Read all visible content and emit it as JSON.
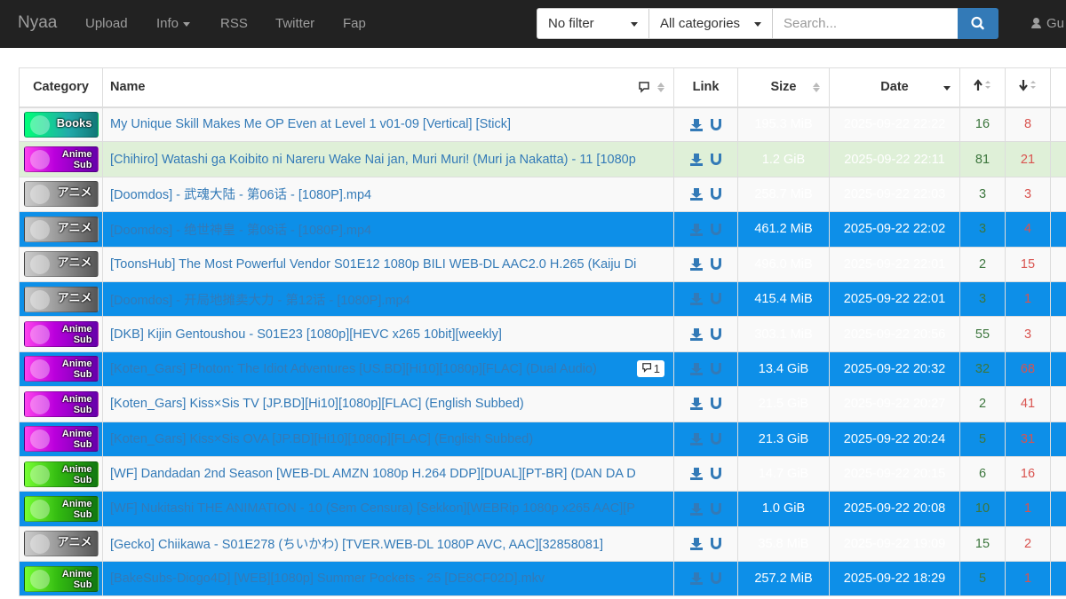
{
  "nav": {
    "brand": "Nyaa",
    "items": [
      "Upload",
      "Info",
      "RSS",
      "Twitter",
      "Fap"
    ],
    "filter": "No filter",
    "category": "All categories",
    "search_placeholder": "Search...",
    "user": "Gu"
  },
  "headers": {
    "category": "Category",
    "name": "Name",
    "link": "Link",
    "size": "Size",
    "date": "Date"
  },
  "rows": [
    {
      "cat": "books",
      "cat_label": "Books",
      "name": "My Unique Skill Makes Me OP Even at Level 1 v01-09 [Vertical] [Stick]",
      "size": "195.3 MiB",
      "date": "2025-09-22 22:22",
      "seeders": "16",
      "leechers": "8",
      "style": "default",
      "comments": ""
    },
    {
      "cat": "sub",
      "cat_label": "Anime Sub",
      "name": "[Chihiro] Watashi ga Koibito ni Nareru Wake Nai jan, Muri Muri! (Muri ja Nakatta) - 11 [1080p",
      "size": "1.2 GiB",
      "date": "2025-09-22 22:11",
      "seeders": "81",
      "leechers": "21",
      "style": "success",
      "comments": ""
    },
    {
      "cat": "raw",
      "cat_label": "アニメ",
      "name": "[Doomdos] - 武魂大陆 - 第06话 - [1080P].mp4",
      "size": "258.7 MiB",
      "date": "2025-09-22 22:03",
      "seeders": "3",
      "leechers": "3",
      "style": "default",
      "comments": ""
    },
    {
      "cat": "raw",
      "cat_label": "アニメ",
      "name": "[Doomdos] - 绝世神皇 - 第08话 - [1080P].mp4",
      "size": "461.2 MiB",
      "date": "2025-09-22 22:02",
      "seeders": "3",
      "leechers": "4",
      "style": "sel",
      "comments": ""
    },
    {
      "cat": "raw",
      "cat_label": "アニメ",
      "name": "[ToonsHub] The Most Powerful Vendor S01E12 1080p BILI WEB-DL AAC2.0 H.265 (Kaiju Di",
      "size": "496.0 MiB",
      "date": "2025-09-22 22:01",
      "seeders": "2",
      "leechers": "15",
      "style": "default",
      "comments": ""
    },
    {
      "cat": "raw",
      "cat_label": "アニメ",
      "name": "[Doomdos] - 开局地摊卖大力 - 第12话 - [1080P].mp4",
      "size": "415.4 MiB",
      "date": "2025-09-22 22:01",
      "seeders": "3",
      "leechers": "1",
      "style": "sel",
      "comments": ""
    },
    {
      "cat": "sub",
      "cat_label": "Anime Sub",
      "name": "[DKB] Kijin Gentoushou - S01E23 [1080p][HEVC x265 10bit][weekly]",
      "size": "303.1 MiB",
      "date": "2025-09-22 20:56",
      "seeders": "55",
      "leechers": "3",
      "style": "default",
      "comments": ""
    },
    {
      "cat": "sub",
      "cat_label": "Anime Sub",
      "name": "[Koten_Gars] Photon: The Idiot Adventures [US.BD][Hi10][1080p][FLAC] (Dual Audio)",
      "size": "13.4 GiB",
      "date": "2025-09-22 20:32",
      "seeders": "32",
      "leechers": "68",
      "style": "sel",
      "comments": "1"
    },
    {
      "cat": "sub",
      "cat_label": "Anime Sub",
      "name": "[Koten_Gars] Kiss×Sis TV [JP.BD][Hi10][1080p][FLAC] (English Subbed)",
      "size": "21.5 GiB",
      "date": "2025-09-22 20:27",
      "seeders": "2",
      "leechers": "41",
      "style": "default",
      "comments": ""
    },
    {
      "cat": "sub",
      "cat_label": "Anime Sub",
      "name": "[Koten_Gars] Kiss×Sis OVA [JP.BD][Hi10][1080p][FLAC] (English Subbed)",
      "size": "21.3 GiB",
      "date": "2025-09-22 20:24",
      "seeders": "5",
      "leechers": "31",
      "style": "sel",
      "comments": ""
    },
    {
      "cat": "eng",
      "cat_label": "Anime Sub",
      "name": "[WF] Dandadan 2nd Season [WEB-DL AMZN 1080p H.264 DDP][DUAL][PT-BR] (DAN DA D",
      "size": "14.7 GiB",
      "date": "2025-09-22 20:15",
      "seeders": "6",
      "leechers": "16",
      "style": "default",
      "comments": ""
    },
    {
      "cat": "eng",
      "cat_label": "Anime Sub",
      "name": "[WF] Nukitashi THE ANIMATION - 10 (Sem Censura) [Sekkon][WEBRip 1080p x265 AAC][P",
      "size": "1.0 GiB",
      "date": "2025-09-22 20:08",
      "seeders": "10",
      "leechers": "1",
      "style": "sel",
      "comments": ""
    },
    {
      "cat": "raw",
      "cat_label": "アニメ",
      "name": "[Gecko] Chiikawa - S01E278 (ちいかわ) [TVER.WEB-DL 1080P AVC, AAC][32858081]",
      "size": "35.8 MiB",
      "date": "2025-09-22 19:09",
      "seeders": "15",
      "leechers": "2",
      "style": "default",
      "comments": ""
    },
    {
      "cat": "eng",
      "cat_label": "Anime Sub",
      "name": "[BakeSubs-Diogo4D] [WEB][1080p] Summer Pockets - 25 [DE8CF02D].mkv",
      "size": "257.2 MiB",
      "date": "2025-09-22 18:29",
      "seeders": "5",
      "leechers": "1",
      "style": "sel",
      "comments": ""
    }
  ]
}
